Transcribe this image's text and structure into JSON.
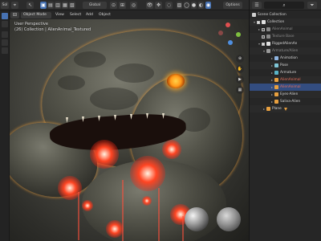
{
  "top_bar": {
    "editor_label": "Sol",
    "global_label": "Global",
    "options_label": "Options"
  },
  "sub_bar": {
    "mode_label": "Object Mode",
    "menus": [
      "View",
      "Select",
      "Add",
      "Object"
    ]
  },
  "viewport": {
    "perspective_label": "User Perspective",
    "collection_label": "(26) Collection | AlienAnimal_Textured"
  },
  "outliner": {
    "rows": [
      {
        "label": "Scene Collection",
        "style": "normal"
      },
      {
        "label": "Collection",
        "style": "normal"
      },
      {
        "label": "AlienAnimal",
        "style": "dim"
      },
      {
        "label": "Texture Base",
        "style": "dim"
      },
      {
        "label": "RiggedAlienAn",
        "style": "normal"
      },
      {
        "label": "Armature/Alien",
        "style": "dim"
      },
      {
        "label": "Animation",
        "style": "normal"
      },
      {
        "label": "Pose",
        "style": "normal"
      },
      {
        "label": "Armature",
        "style": "normal"
      },
      {
        "label": "AlienAnimal",
        "style": "red"
      },
      {
        "label": "AlienAnimal",
        "style": "red"
      },
      {
        "label": "Eyes-Alien",
        "style": "normal"
      },
      {
        "label": "Saliva-Alien",
        "style": "normal"
      },
      {
        "label": "Plane",
        "style": "normal"
      }
    ]
  },
  "colors": {
    "accent": "#4772b3",
    "selection": "#334d80",
    "warning_text": "#e56d5a"
  }
}
